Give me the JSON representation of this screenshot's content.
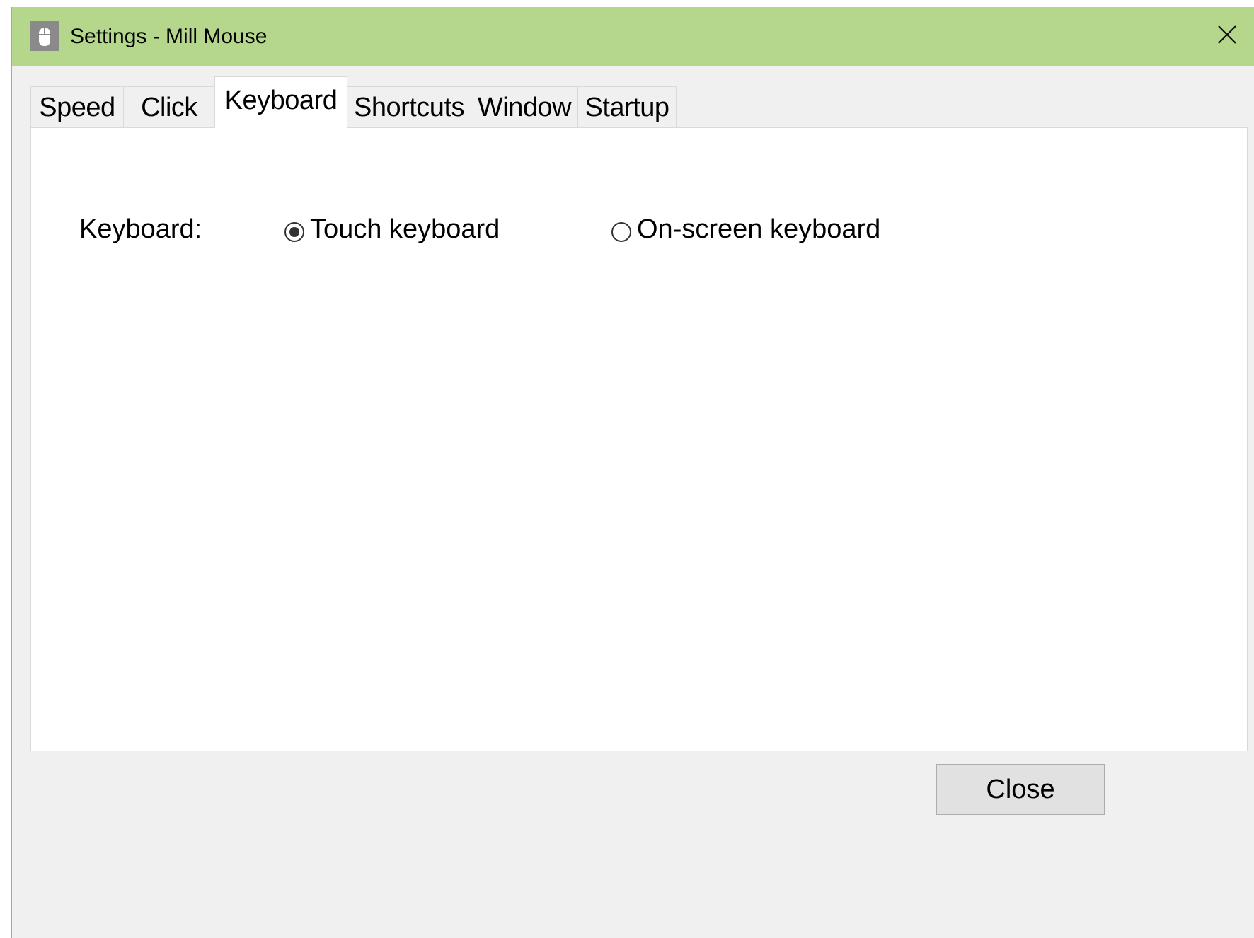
{
  "window": {
    "title": "Settings - Mill Mouse",
    "app_icon": "mouse-icon",
    "close_icon": "close-icon"
  },
  "tabs": [
    {
      "label": "Speed",
      "active": false
    },
    {
      "label": "Click",
      "active": false
    },
    {
      "label": "Keyboard",
      "active": true
    },
    {
      "label": "Shortcuts",
      "active": false
    },
    {
      "label": "Window",
      "active": false
    },
    {
      "label": "Startup",
      "active": false
    }
  ],
  "keyboard": {
    "label": "Keyboard:",
    "options": [
      {
        "label": "Touch keyboard",
        "checked": true
      },
      {
        "label": "On-screen keyboard",
        "checked": false
      }
    ]
  },
  "footer": {
    "close_label": "Close"
  },
  "colors": {
    "titlebar": "#b4d78b",
    "window_bg": "#f0f0f0",
    "panel_bg": "#ffffff"
  }
}
